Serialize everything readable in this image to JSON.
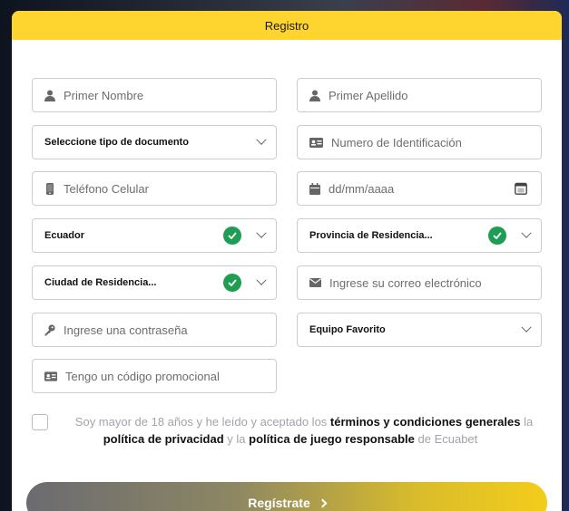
{
  "header": {
    "title": "Registro"
  },
  "fields": {
    "first_name": {
      "placeholder": "Primer Nombre"
    },
    "last_name": {
      "placeholder": "Primer Apellido"
    },
    "doc_type": {
      "value": "Seleccione tipo de documento"
    },
    "id_number": {
      "placeholder": "Numero de Identificación"
    },
    "phone": {
      "placeholder": "Teléfono Celular"
    },
    "birthdate": {
      "placeholder": "dd/mm/aaaa"
    },
    "country": {
      "value": "Ecuador"
    },
    "province": {
      "value": "Provincia de Residencia..."
    },
    "city": {
      "value": "Ciudad de Residencia..."
    },
    "email": {
      "placeholder": "Ingrese su correo electrónico"
    },
    "password": {
      "placeholder": "Ingrese una contraseña"
    },
    "team": {
      "value": "Equipo Favorito"
    },
    "promo": {
      "placeholder": "Tengo un código promocional"
    }
  },
  "terms": {
    "p1": "Soy mayor de 18 años y he leído y aceptado los ",
    "link1": "términos y condiciones generales",
    "p2": " la ",
    "link2": "política de privacidad",
    "p3": " y la ",
    "link3": "política de juego responsable",
    "p4": " de Ecuabet"
  },
  "submit": {
    "label": "Regístrate"
  },
  "colors": {
    "accent": "#fed42f",
    "check": "#1f9d55"
  },
  "icons": {
    "first_name": "user-icon",
    "last_name": "user-icon",
    "id_number": "id-card-icon",
    "phone": "phone-icon",
    "birthdate": "calendar-icon",
    "email": "envelope-icon",
    "password": "key-icon",
    "promo": "id-card-icon"
  }
}
